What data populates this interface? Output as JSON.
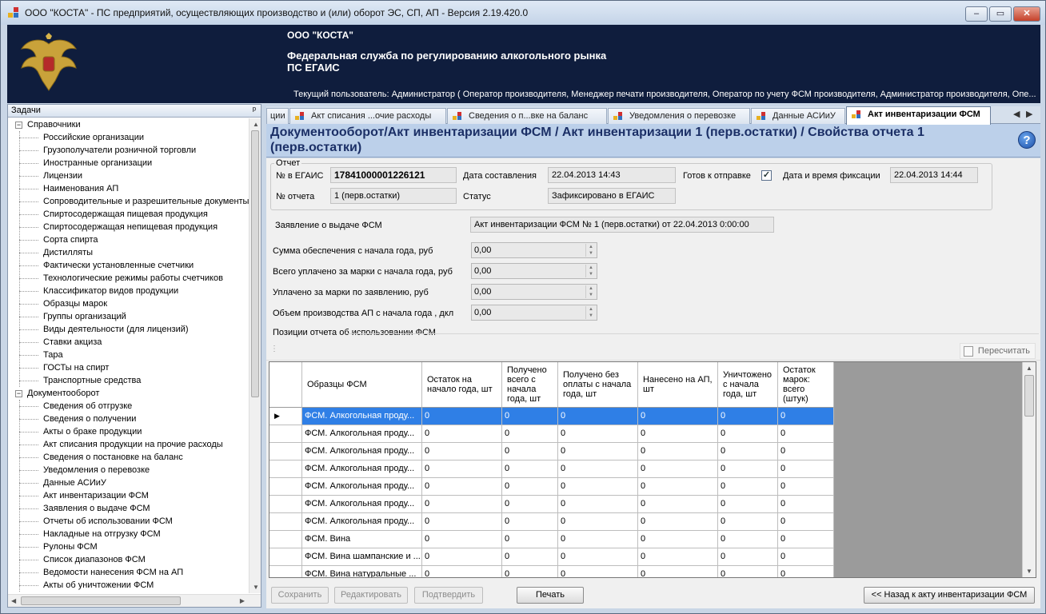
{
  "window": {
    "title": "ООО \"КОСТА\" - ПС предприятий, осуществляющих производство и (или) оборот ЭС, СП, АП - Версия 2.19.420.0",
    "minimize": "‒",
    "maximize": "▭",
    "close": "✕"
  },
  "banner": {
    "org": "ООО \"КОСТА\"",
    "service_line1": "Федеральная служба по регулированию алкогольного рынка",
    "service_line2": "ПС ЕГАИС",
    "user": "Текущий пользователь: Администратор ( Оператор производителя, Менеджер печати производителя, Оператор по учету ФСМ производителя, Администратор производителя, Опе..."
  },
  "tasks": {
    "header": "Задачи",
    "pin": "ᵖ",
    "groups": [
      {
        "label": "Справочники",
        "toggle": "−",
        "items": [
          "Российские организации",
          "Грузополучатели розничной торговли",
          "Иностранные организации",
          "Лицензии",
          "Наименования АП",
          "Сопроводительные и разрешительные документы",
          "Спиртосодержащая пищевая продукция",
          "Спиртосодержащая непищевая продукция",
          "Сорта спирта",
          "Дистилляты",
          "Фактически установленные счетчики",
          "Технологические режимы работы счетчиков",
          "Классификатор видов продукции",
          "Образцы марок",
          "Группы организаций",
          "Виды деятельности (для лицензий)",
          "Ставки акциза",
          "Тара",
          "ГОСТы на спирт",
          "Транспортные средства"
        ]
      },
      {
        "label": "Документооборот",
        "toggle": "−",
        "items": [
          "Сведения об отгрузке",
          "Сведения о получении",
          "Акты о браке продукции",
          "Акт списания продукции на прочие расходы",
          "Сведения о постановке на баланс",
          "Уведомления о перевозке",
          "Данные АСИиУ",
          "Акт инвентаризации ФСМ",
          "Заявления о выдаче ФСМ",
          "Отчеты об использовании ФСМ",
          "Накладные на отгрузку ФСМ",
          "Рулоны ФСМ",
          "Список диапазонов ФСМ",
          "Ведомости нанесения ФСМ на АП",
          "Акты об уничтожении ФСМ"
        ]
      }
    ]
  },
  "tabs": [
    {
      "label": "ции",
      "icon": false
    },
    {
      "label": "Акт списания ...очие расходы",
      "icon": true
    },
    {
      "label": "Сведения о п...вке на баланс",
      "icon": true
    },
    {
      "label": "Уведомления о перевозке",
      "icon": true
    },
    {
      "label": "Данные АСИиУ",
      "icon": true
    },
    {
      "label": "Акт инвентаризации ФСМ",
      "icon": true,
      "active": true
    }
  ],
  "tab_nav": {
    "prev": "◀",
    "next": "▶"
  },
  "doc": {
    "title": "Документооборот/Акт инвентаризации ФСМ / Акт инвентаризации  1 (перв.остатки) / Свойства отчета 1 (перв.остатки)",
    "help": "?"
  },
  "report": {
    "group_label": "Отчет",
    "egais_label": "№ в ЕГАИС",
    "egais_value": "17841000001226121",
    "date_label": "Дата составления",
    "date_value": "22.04.2013 14:43",
    "ready_label": "Готов к отправке",
    "ready_checked": "✓",
    "fix_label": "Дата и время фиксации",
    "fix_value": "22.04.2013 14:44",
    "num_label": "№ отчета",
    "num_value": "1 (перв.остатки)",
    "status_label": "Статус",
    "status_value": "Зафиксировано в ЕГАИС"
  },
  "application": {
    "label": "Заявление о выдаче ФСМ",
    "value": "Акт инвентаризации ФСМ № 1 (перв.остатки) от 22.04.2013 0:00:00"
  },
  "sums": [
    {
      "label": "Сумма обеспечения с начала года, руб",
      "value": "0,00"
    },
    {
      "label": "Всего уплачено  за  марки  с  начала года, руб",
      "value": "0,00"
    },
    {
      "label": "Уплачено за марки по заявлению, руб",
      "value": "0,00"
    },
    {
      "label": "Объем производства АП с начала года , дкл",
      "value": "0,00"
    }
  ],
  "positions": {
    "label": "Позиции отчета об использовании ФСМ",
    "recalc": "Пересчитать",
    "columns": [
      "Образцы ФСМ",
      "Остаток на начало года, шт",
      "Получено всего с начала года, шт",
      "Получено без оплаты с начала года, шт",
      "Нанесено на АП, шт",
      "Уничтожено с начала года, шт",
      "Остаток марок: всего (штук)"
    ],
    "rows": [
      [
        "ФСМ. Алкогольная проду...",
        "0",
        "0",
        "0",
        "0",
        "0",
        "0"
      ],
      [
        "ФСМ. Алкогольная проду...",
        "0",
        "0",
        "0",
        "0",
        "0",
        "0"
      ],
      [
        "ФСМ. Алкогольная проду...",
        "0",
        "0",
        "0",
        "0",
        "0",
        "0"
      ],
      [
        "ФСМ. Алкогольная проду...",
        "0",
        "0",
        "0",
        "0",
        "0",
        "0"
      ],
      [
        "ФСМ. Алкогольная проду...",
        "0",
        "0",
        "0",
        "0",
        "0",
        "0"
      ],
      [
        "ФСМ. Алкогольная проду...",
        "0",
        "0",
        "0",
        "0",
        "0",
        "0"
      ],
      [
        "ФСМ. Алкогольная проду...",
        "0",
        "0",
        "0",
        "0",
        "0",
        "0"
      ],
      [
        "ФСМ. Вина",
        "0",
        "0",
        "0",
        "0",
        "0",
        "0"
      ],
      [
        "ФСМ. Вина шампанские и ...",
        "0",
        "0",
        "0",
        "0",
        "0",
        "0"
      ],
      [
        "ФСМ. Вина натуральные ...",
        "0",
        "0",
        "0",
        "0",
        "0",
        "0"
      ]
    ],
    "current_row_marker": "▶"
  },
  "buttons": {
    "save": "Сохранить",
    "edit": "Редактировать",
    "confirm": "Подтвердить",
    "print": "Печать",
    "back": "<< Назад к акту инвентаризации ФСМ"
  },
  "colors": {
    "selection": "#2f7fe6",
    "banner": "#0f1d3d",
    "title_text": "#1b2f66"
  }
}
